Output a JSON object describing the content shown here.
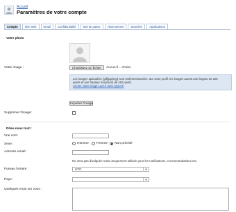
{
  "header": {
    "breadcrumb": "Accueil",
    "title": "Paramètres de votre compte"
  },
  "tabs": [
    {
      "label": "Compte",
      "active": true
    },
    {
      "label": "Site Web",
      "active": false
    },
    {
      "label": "Email",
      "active": false
    },
    {
      "label": "Confidentialité",
      "active": false
    },
    {
      "label": "Mot de passe",
      "active": false
    },
    {
      "label": "Abonnement",
      "active": false
    },
    {
      "label": "Données",
      "active": false
    },
    {
      "label": "Applications",
      "active": false
    }
  ],
  "photo_section": {
    "heading": "Votre photo",
    "image_label": "Votre image :",
    "choose_button": "Choisissez un fichier",
    "no_file": "Aucun fi... choisi",
    "info_line1": "Les images uploadées (gif/jpg/png) sont redimensionnées. Sur votre profil, les images auront une largeur de 106",
    "info_line2": "pixels et une hauteur maximum de 252 pixels.",
    "info_link": "Center votre image Last.fr avec Myco!tr",
    "import_button": "Importer l'image",
    "delete_label": "Supprimer l'image:"
  },
  "about_section": {
    "heading": "Dites-nous tout !",
    "name_label": "Vrai nom:",
    "name_value": "",
    "sex_label": "Sexe:",
    "sex_options": [
      "Homme",
      "Femme",
      "Non précisé"
    ],
    "sex_selected": "Non précisé",
    "email_label": "Adresse email:",
    "email_value": "",
    "email_hint": "Ne sera pas divulguée mais uniquement utilisée pour les notifications, recommandations etc.",
    "timezone_label": "Fuseau horaire :",
    "timezone_value": "UTC",
    "country_label": "Pays:",
    "country_value": "",
    "about_label": "Quelques mots sur vous :",
    "about_value": ""
  },
  "colors": {
    "link": "#2a5db0",
    "tab_border": "#b7c6d9",
    "info_bg": "#dde7f3"
  }
}
